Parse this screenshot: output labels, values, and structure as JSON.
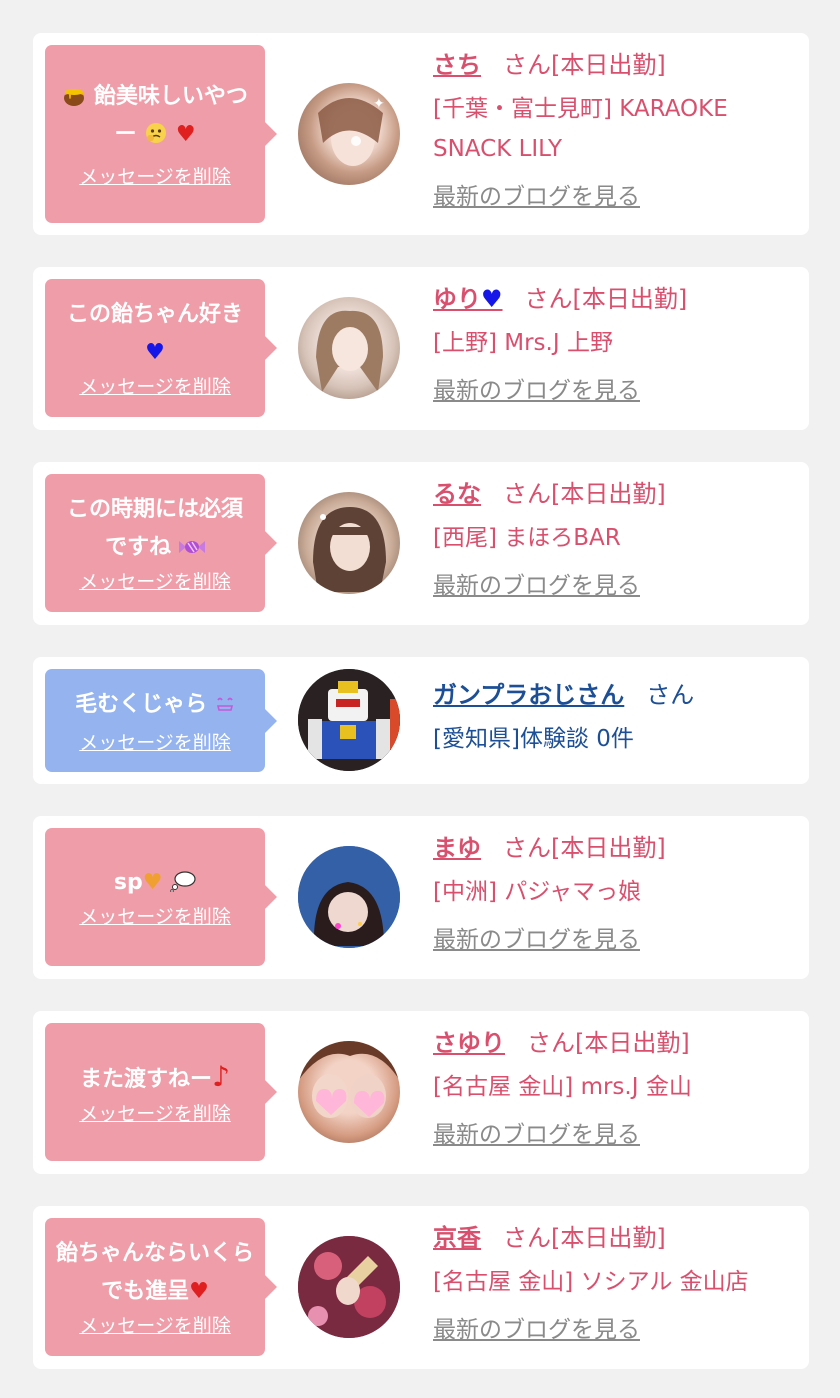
{
  "delete_label": "メッセージを削除",
  "blog_label": "最新のブログを見る",
  "cards": [
    {
      "message_text": "飴美味しいやつー",
      "message_emojis": [
        "honey-pot-icon",
        "face-holding-back-tears-icon",
        "red-heart-icon"
      ],
      "name": "さち",
      "suffix": "さん[本日出勤]",
      "shop": "[千葉・富士見町] KARAOKE SNACK LILY"
    },
    {
      "message_text": "この飴ちゃん好き",
      "message_emojis": [
        "blue-heart-icon"
      ],
      "name": "ゆり",
      "name_emoji": "blue-heart-icon",
      "suffix": "さん[本日出勤]",
      "shop": "[上野] Mrs.J 上野"
    },
    {
      "message_text": "この時期には必須ですね",
      "message_emojis": [
        "candy-icon"
      ],
      "name": "るな",
      "suffix": "さん[本日出勤]",
      "shop": "[西尾] まほろBAR"
    },
    {
      "message_text": "毛むくじゃら",
      "message_emojis": [
        "smiling-face-icon"
      ],
      "name": "ガンプラおじさん",
      "suffix": "さん",
      "shop": "[愛知県]体験談 0件"
    },
    {
      "message_text": "sp",
      "message_emojis": [
        "orange-heart-icon",
        "thought-bubble-icon"
      ],
      "name": "まゆ",
      "suffix": "さん[本日出勤]",
      "shop": "[中洲] パジャマっ娘"
    },
    {
      "message_text": "また渡すねー",
      "message_emojis": [
        "music-note-icon"
      ],
      "name": "さゆり",
      "suffix": "さん[本日出勤]",
      "shop": "[名古屋 金山] mrs.J 金山"
    },
    {
      "message_text": "飴ちゃんならいくらでも進呈",
      "message_emojis": [
        "red-heart-icon"
      ],
      "name": "京香",
      "suffix": "さん[本日出勤]",
      "shop": "[名古屋 金山] ソシアル 金山店"
    }
  ],
  "colors": {
    "page_bg": "#f1f1f1",
    "bubble_pink": "#ef9ea9",
    "bubble_blue": "#94b3ef",
    "name_pink": "#d9506e",
    "name_blue": "#1c4f96",
    "blog_gray": "#8a8a8a"
  }
}
